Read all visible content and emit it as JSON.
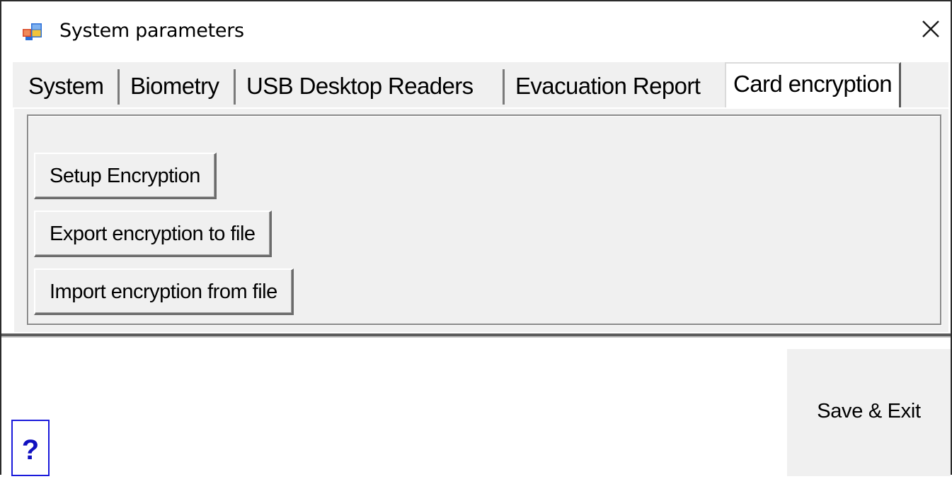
{
  "window": {
    "title": "System parameters",
    "app_icon": "application-window-icon",
    "close_icon": "close-icon",
    "close_glyph": "✕"
  },
  "tabs": [
    {
      "label": "System",
      "active": false
    },
    {
      "label": "Biometry",
      "active": false
    },
    {
      "label": "USB Desktop Readers",
      "active": false
    },
    {
      "label": "Evacuation Report",
      "active": false
    },
    {
      "label": "Card encryption",
      "active": true
    }
  ],
  "card_encryption": {
    "setup_label": "Setup Encryption",
    "export_label": "Export encryption to file",
    "import_label": "Import encryption from file"
  },
  "footer": {
    "help_label": "?",
    "save_exit_label": "Save & Exit"
  },
  "colors": {
    "panel_bg": "#f0f0f0",
    "help_border": "#1a1adb",
    "help_text": "#1010c0"
  }
}
